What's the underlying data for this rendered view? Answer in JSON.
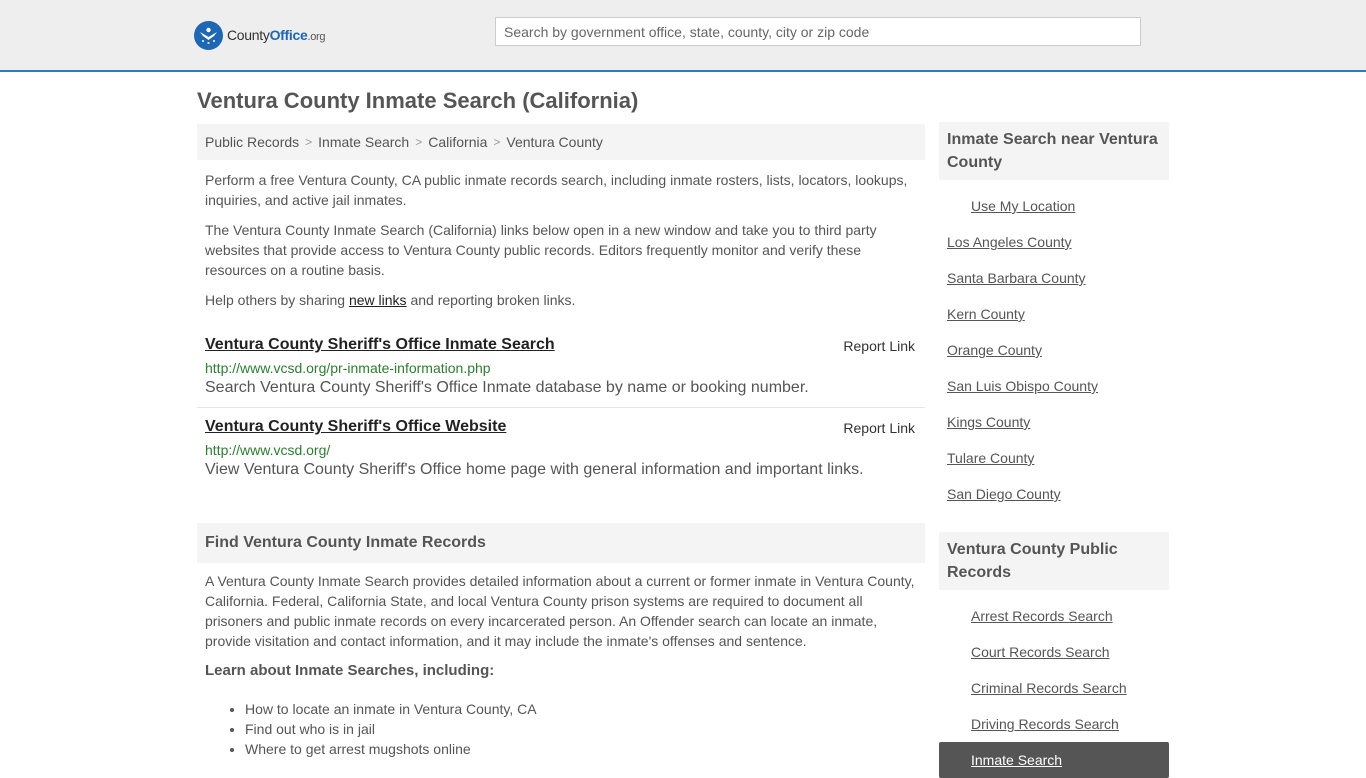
{
  "header": {
    "logo": {
      "part1": "County",
      "part2": "Office",
      "part3": ".org",
      "icon": "seal-star-icon"
    },
    "search_placeholder": "Search by government office, state, county, city or zip code",
    "accent_color": "#2a7bc4"
  },
  "page_title": "Ventura County Inmate Search (California)",
  "breadcrumb": [
    "Public Records",
    "Inmate Search",
    "California",
    "Ventura County"
  ],
  "intro": {
    "p1": "Perform a free Ventura County, CA public inmate records search, including inmate rosters, lists, locators, lookups, inquiries, and active jail inmates.",
    "p2": "The Ventura County Inmate Search (California) links below open in a new window and take you to third party websites that provide access to Ventura County public records. Editors frequently monitor and verify these resources on a routine basis.",
    "p3_before": "Help others by sharing ",
    "p3_link": "new links",
    "p3_after": " and reporting broken links."
  },
  "results": [
    {
      "title": "Ventura County Sheriff's Office Inmate Search",
      "report": "Report Link",
      "url": "http://www.vcsd.org/pr-inmate-information.php",
      "desc": "Search Ventura County Sheriff's Office Inmate database by name or booking number."
    },
    {
      "title": "Ventura County Sheriff's Office Website",
      "report": "Report Link",
      "url": "http://www.vcsd.org/",
      "desc": "View Ventura County Sheriff's Office home page with general information and important links."
    }
  ],
  "find_section": {
    "heading": "Find Ventura County Inmate Records",
    "body": "A Ventura County Inmate Search provides detailed information about a current or former inmate in Ventura County, California. Federal, California State, and local Ventura County prison systems are required to document all prisoners and public inmate records on every incarcerated person. An Offender search can locate an inmate, provide visitation and contact information, and it may include the inmate's offenses and sentence.",
    "learn_heading": "Learn about Inmate Searches, including:",
    "learn_items": [
      "How to locate an inmate in Ventura County, CA",
      "Find out who is in jail",
      "Where to get arrest mugshots online"
    ]
  },
  "sidebar": {
    "nearby_heading": "Inmate Search near Ventura County",
    "use_location": "Use My Location",
    "nearby": [
      "Los Angeles County",
      "Santa Barbara County",
      "Kern County",
      "Orange County",
      "San Luis Obispo County",
      "Kings County",
      "Tulare County",
      "San Diego County"
    ],
    "records_heading": "Ventura County Public Records",
    "records": [
      "Arrest Records Search",
      "Court Records Search",
      "Criminal Records Search",
      "Driving Records Search"
    ],
    "active": "Inmate Search"
  }
}
